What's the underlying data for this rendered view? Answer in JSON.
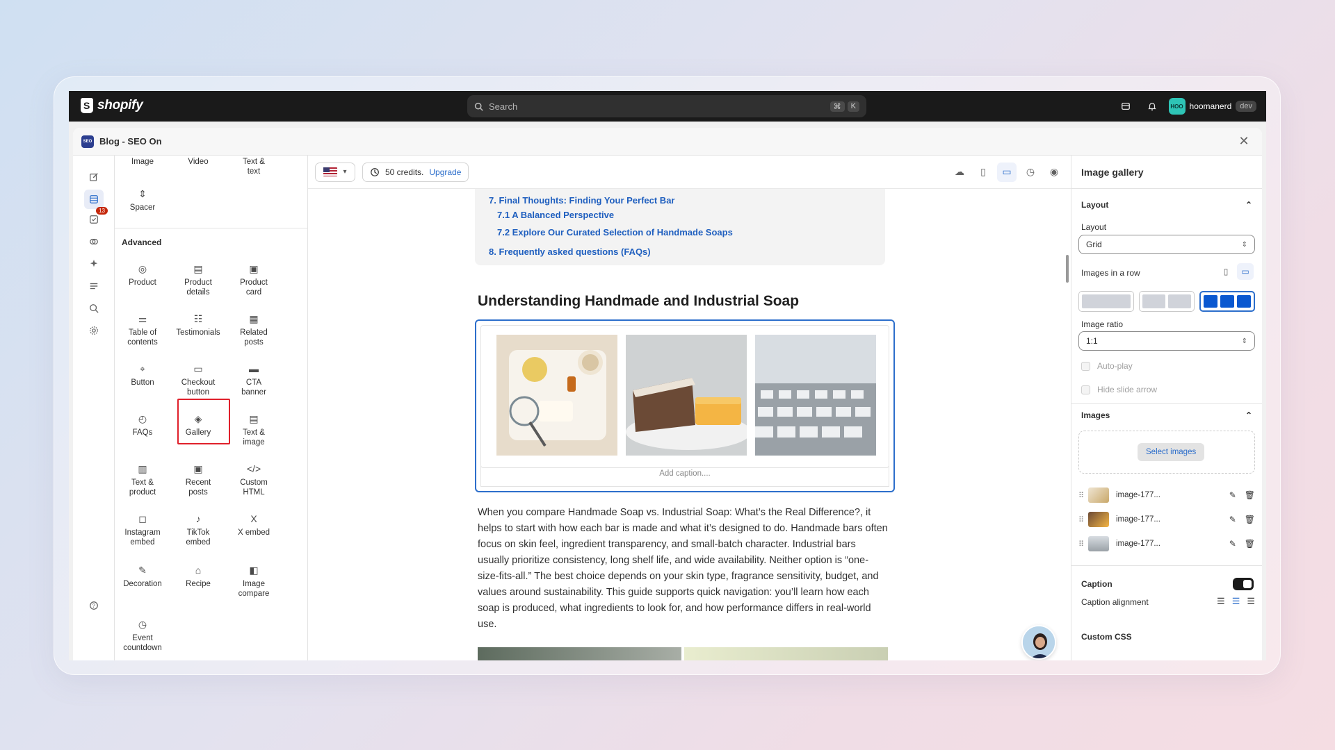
{
  "topbar": {
    "brand": "shopify",
    "search_placeholder": "Search",
    "shortcut_keys": [
      "⌘",
      "K"
    ],
    "user_initials": "HOO",
    "user_name": "hoomanerd",
    "user_tag": "dev"
  },
  "modal": {
    "app_badge": "SEO",
    "title": "Blog - SEO On",
    "close": "✕"
  },
  "rail": {
    "badge_count": "13"
  },
  "blocks": {
    "top": [
      {
        "label": "Image",
        "icon": "image-icon"
      },
      {
        "label": "Video",
        "icon": "video-icon"
      },
      {
        "label": "Text &\ntext",
        "icon": "text-text-icon"
      },
      {
        "label": "Spacer",
        "icon": "spacer-icon"
      }
    ],
    "advanced_label": "Advanced",
    "advanced": [
      {
        "label": "Product",
        "icon": "tag-icon"
      },
      {
        "label": "Product\ndetails",
        "icon": "product-details-icon"
      },
      {
        "label": "Product\ncard",
        "icon": "product-card-icon"
      },
      {
        "label": "Table of\ncontents",
        "icon": "sliders-icon"
      },
      {
        "label": "Testimonials",
        "icon": "testimonials-icon"
      },
      {
        "label": "Related\nposts",
        "icon": "related-posts-icon"
      },
      {
        "label": "Button",
        "icon": "cursor-icon"
      },
      {
        "label": "Checkout\nbutton",
        "icon": "checkout-icon"
      },
      {
        "label": "CTA\nbanner",
        "icon": "banner-icon"
      },
      {
        "label": "FAQs",
        "icon": "faq-icon"
      },
      {
        "label": "Gallery",
        "icon": "gallery-icon"
      },
      {
        "label": "Text &\nimage",
        "icon": "text-image-icon"
      },
      {
        "label": "Text &\nproduct",
        "icon": "text-product-icon"
      },
      {
        "label": "Recent\nposts",
        "icon": "recent-posts-icon"
      },
      {
        "label": "Custom\nHTML",
        "icon": "code-icon"
      },
      {
        "label": "Instagram\nembed",
        "icon": "instagram-icon"
      },
      {
        "label": "TikTok\nembed",
        "icon": "tiktok-icon"
      },
      {
        "label": "X embed",
        "icon": "x-icon"
      },
      {
        "label": "Decoration",
        "icon": "brush-icon"
      },
      {
        "label": "Recipe",
        "icon": "chef-hat-icon"
      },
      {
        "label": "Image\ncompare",
        "icon": "compare-icon"
      },
      {
        "label": "Event\ncountdown",
        "icon": "clock-icon"
      }
    ]
  },
  "canvas_bar": {
    "credits_text": "50 credits.",
    "upgrade_link": "Upgrade"
  },
  "doc": {
    "toc": [
      "7. Final Thoughts: Finding Your Perfect Bar",
      "7.1 A Balanced Perspective",
      "7.2 Explore Our Curated Selection of Handmade Soaps",
      "8. Frequently asked questions (FAQs)"
    ],
    "heading": "Understanding Handmade and Industrial Soap",
    "caption_placeholder": "Add caption....",
    "paragraph": "When you compare Handmade Soap vs. Industrial Soap: What’s the Real Difference?, it helps to start with how each bar is made and what it’s designed to do. Handmade bars often focus on skin feel, ingredient transparency, and small-batch character. Industrial bars usually prioritize consistency, long shelf life, and wide availability. Neither option is “one-size-fits-all.” The best choice depends on your skin type, fragrance sensitivity, budget, and values around sustainability. This guide supports quick navigation: you’ll learn how each soap is produced, what ingredients to look for, and how performance differs in real-world use."
  },
  "panel": {
    "title": "Image gallery",
    "layout_section": "Layout",
    "layout_label": "Layout",
    "layout_value": "Grid",
    "images_in_row_label": "Images in a row",
    "images_in_row_selected": 3,
    "ratio_label": "Image ratio",
    "ratio_value": "1:1",
    "autoplay_label": "Auto-play",
    "hide_arrow_label": "Hide slide arrow",
    "images_section": "Images",
    "select_images": "Select images",
    "images": [
      "image-177...",
      "image-177...",
      "image-177..."
    ],
    "caption_label": "Caption",
    "caption_on": true,
    "caption_alignment_label": "Caption alignment",
    "caption_alignment": "center",
    "custom_css_label": "Custom CSS"
  }
}
